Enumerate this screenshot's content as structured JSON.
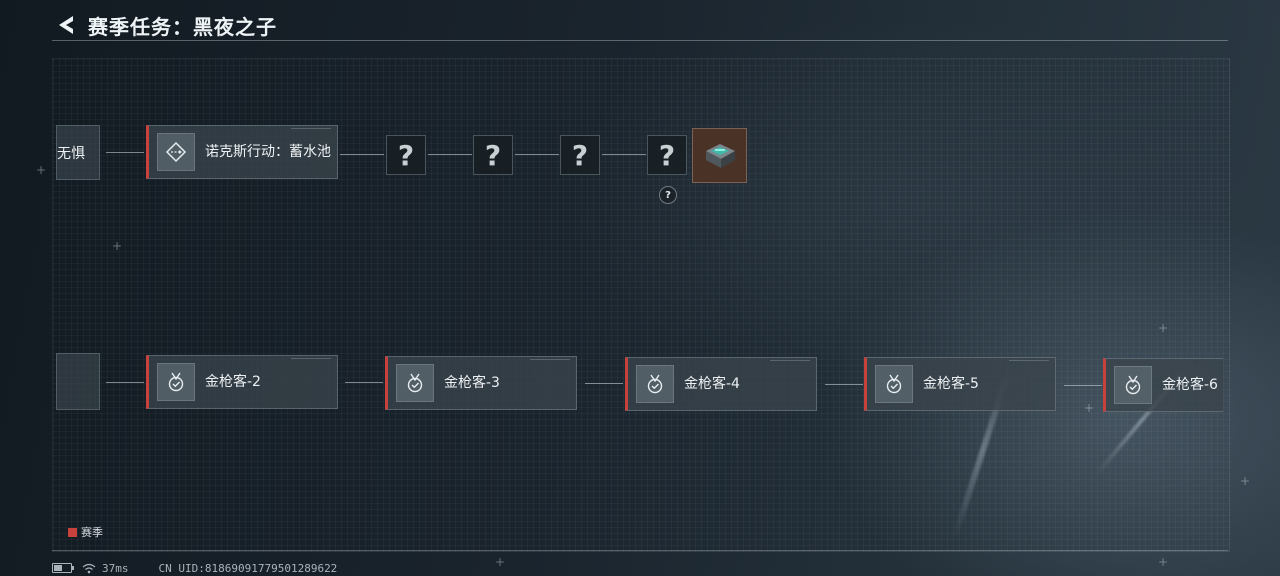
{
  "header": {
    "title": "赛季任务：黑夜之子"
  },
  "top_row": {
    "partial_label": "无惧",
    "first_task": "诺克斯行动：蓄水池",
    "mystery_symbol": "?",
    "reward_badge": "?"
  },
  "bottom_row": {
    "tasks": [
      "金枪客-2",
      "金枪客-3",
      "金枪客-4",
      "金枪客-5",
      "金枪客-6"
    ]
  },
  "legend": {
    "label": "赛季",
    "color": "#c7423c"
  },
  "status": {
    "ping": "37ms",
    "uid": "CN UID:81869091779501289622"
  }
}
